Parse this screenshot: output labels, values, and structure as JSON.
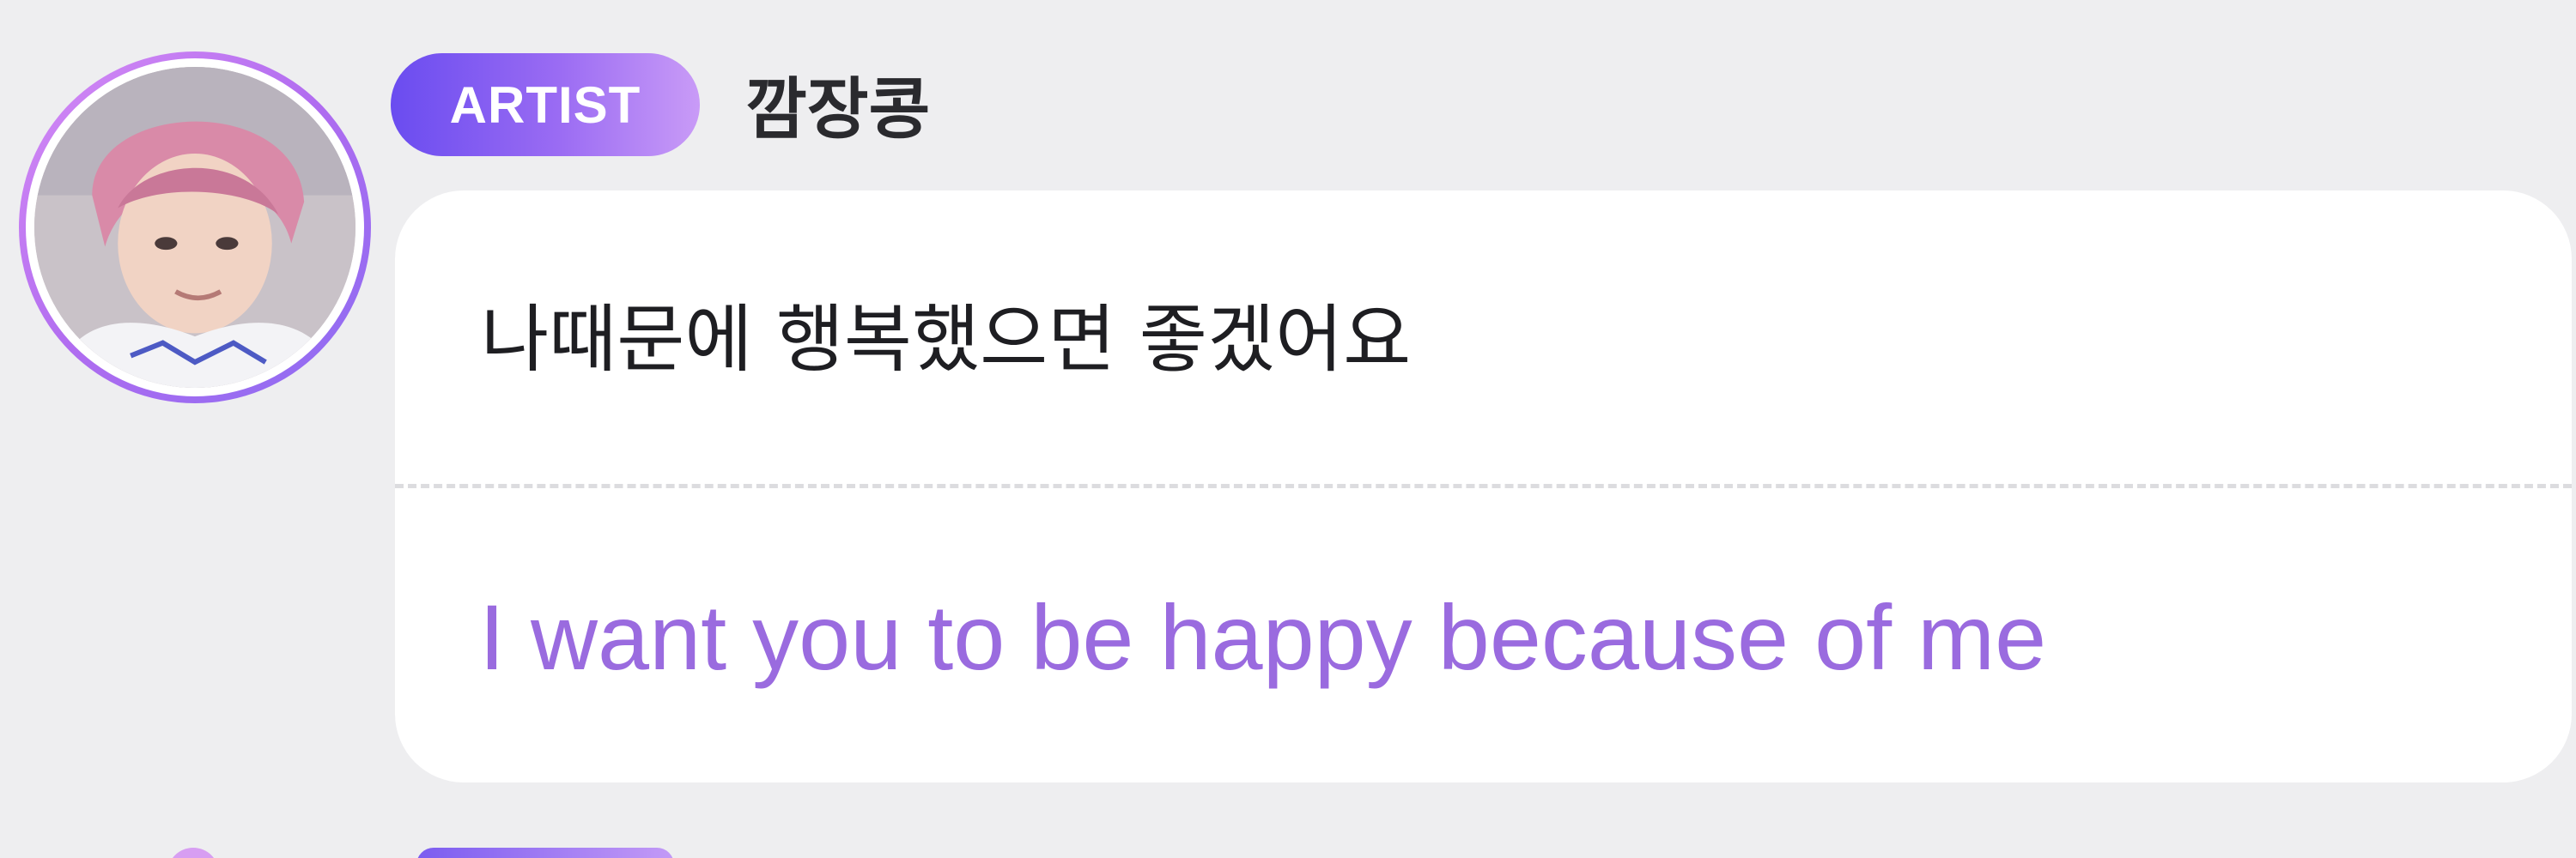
{
  "message": {
    "badge_label": "ARTIST",
    "author_name": "깜장콩",
    "original_text": "나때문에 행복했으면 좋겠어요",
    "translated_text": "I want you to be happy because of me"
  },
  "colors": {
    "background": "#eeeef0",
    "bubble": "#ffffff",
    "badge_gradient_start": "#6a4cf0",
    "badge_gradient_end": "#c99bf7",
    "translation_text": "#9a6bdf",
    "avatar_ring": "#b06cf0"
  },
  "icons": {
    "avatar": "artist-profile-photo"
  }
}
